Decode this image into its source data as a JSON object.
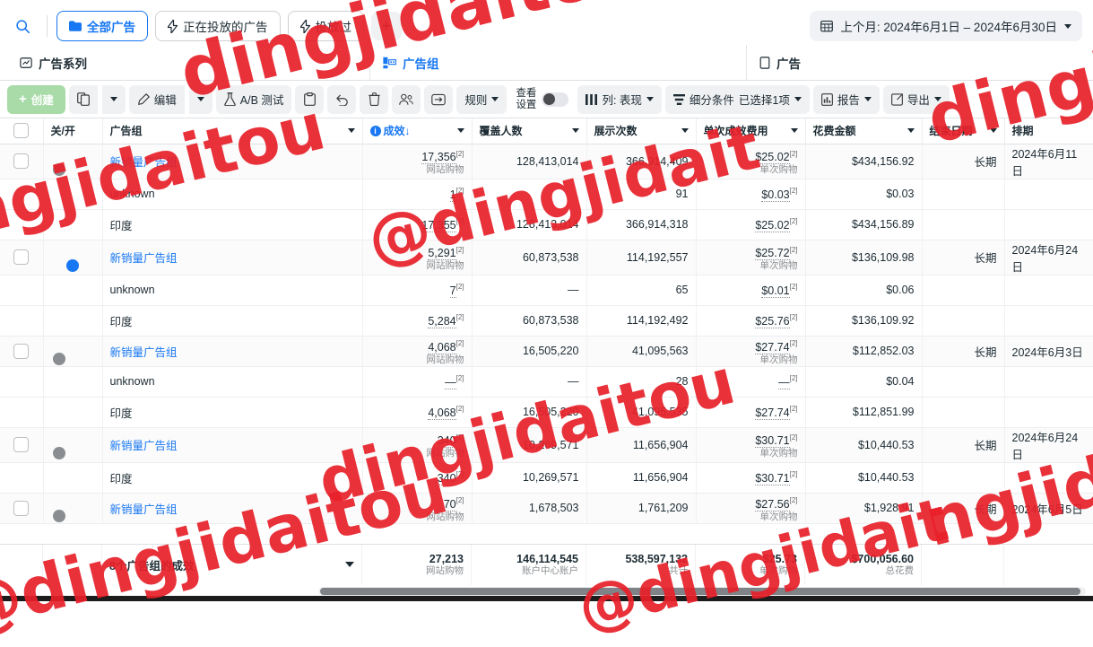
{
  "topbar": {
    "search_icon": "search-icon",
    "filters": [
      {
        "label": "全部广告",
        "icon": "folder-icon",
        "active": true
      },
      {
        "label": "正在投放的广告",
        "icon": "bolt-icon",
        "active": false
      },
      {
        "label": "投放过",
        "icon": "bolt-icon",
        "active": false
      }
    ],
    "add_label": "+",
    "date_range": "上个月: 2024年6月1日 – 2024年6月30日",
    "date_icon": "calendar-icon"
  },
  "object_tabs": [
    {
      "label": "广告系列",
      "icon": "campaign-icon",
      "active": false
    },
    {
      "label": "广告组",
      "icon": "adset-icon",
      "active": true
    },
    {
      "label": "广告",
      "icon": "ad-icon",
      "active": false
    }
  ],
  "toolbar": {
    "create_label": "创建",
    "duplicate_icon": "duplicate-icon",
    "duplicate_caret": "▾",
    "edit_label": "编辑",
    "edit_caret": "▾",
    "abtest_label": "A/B 测试",
    "abtest_icon": "flask-icon",
    "clipboard_icon": "clipboard-icon",
    "undo_icon": "undo-icon",
    "trash_icon": "trash-icon",
    "audience_icon": "audience-icon",
    "refresh_icon": "refresh-icon",
    "rules_label": "规则",
    "viewsettings_line1": "查看",
    "viewsettings_line2": "设置",
    "columns_label": "列: 表现",
    "columns_icon": "columns-icon",
    "breakdown_label": "细分条件",
    "breakdown_value": "已选择1项",
    "breakdown_icon": "breakdown-icon",
    "reports_label": "报告",
    "reports_icon": "report-icon",
    "export_label": "导出",
    "export_icon": "export-icon"
  },
  "table": {
    "headers": {
      "toggle": "关/开",
      "name": "广告组",
      "results": "成效",
      "results_sort": "↓",
      "reach": "覆盖人数",
      "impressions": "展示次数",
      "cost_per_result": "单次成效费用",
      "amount_spent": "花费金额",
      "end_date": "结束日期",
      "schedule": "排期"
    },
    "groups": [
      {
        "name": "新销量广告组",
        "toggle_on": false,
        "results": "17,356",
        "results_sub": "网站购物",
        "reach": "128,413,014",
        "impressions": "366,914,409",
        "cost": "$25.02",
        "cost_sub": "单次购物",
        "spent": "$434,156.92",
        "end_date": "长期",
        "schedule": "2024年6月11日",
        "children": [
          {
            "name": "unknown",
            "results": "1",
            "reach": "",
            "impressions": "91",
            "cost": "$0.03",
            "spent": "$0.03"
          },
          {
            "name": "印度",
            "results": "17,355",
            "reach": "128,413,014",
            "impressions": "366,914,318",
            "cost": "$25.02",
            "spent": "$434,156.89"
          }
        ]
      },
      {
        "name": "新销量广告组",
        "toggle_on": true,
        "results": "5,291",
        "results_sub": "网站购物",
        "reach": "60,873,538",
        "impressions": "114,192,557",
        "cost": "$25.72",
        "cost_sub": "单次购物",
        "spent": "$136,109.98",
        "end_date": "长期",
        "schedule": "2024年6月24日",
        "children": [
          {
            "name": "unknown",
            "results": "7",
            "reach": "—",
            "impressions": "65",
            "cost": "$0.01",
            "spent": "$0.06"
          },
          {
            "name": "印度",
            "results": "5,284",
            "reach": "60,873,538",
            "impressions": "114,192,492",
            "cost": "$25.76",
            "spent": "$136,109.92"
          }
        ]
      },
      {
        "name": "新销量广告组",
        "toggle_on": false,
        "results": "4,068",
        "results_sub": "网站购物",
        "reach": "16,505,220",
        "impressions": "41,095,563",
        "cost": "$27.74",
        "cost_sub": "单次购物",
        "spent": "$112,852.03",
        "end_date": "长期",
        "schedule": "2024年6月3日",
        "children": [
          {
            "name": "unknown",
            "results": "—",
            "reach": "—",
            "impressions": "28",
            "cost": "—",
            "spent": "$0.04"
          },
          {
            "name": "印度",
            "results": "4,068",
            "reach": "16,505,220",
            "impressions": "41,095,535",
            "cost": "$27.74",
            "spent": "$112,851.99"
          }
        ]
      },
      {
        "name": "新销量广告组",
        "toggle_on": false,
        "results": "340",
        "results_sub": "网站购物",
        "reach": "10,269,571",
        "impressions": "11,656,904",
        "cost": "$30.71",
        "cost_sub": "单次购物",
        "spent": "$10,440.53",
        "end_date": "长期",
        "schedule": "2024年6月24日",
        "children": [
          {
            "name": "印度",
            "results": "340",
            "reach": "10,269,571",
            "impressions": "11,656,904",
            "cost": "$30.71",
            "spent": "$10,440.53"
          }
        ]
      },
      {
        "name": "新销量广告组",
        "toggle_on": false,
        "results": "70",
        "results_sub": "网站购物",
        "reach": "1,678,503",
        "impressions": "1,761,209",
        "cost": "$27.56",
        "cost_sub": "单次购物",
        "spent": "$1,928.91",
        "end_date": "长期",
        "schedule": "2024年6月5日",
        "children": []
      }
    ],
    "summary": {
      "label": "8个广告组的成效",
      "results": "27,213",
      "results_sub": "网站购物",
      "reach": "146,114,545",
      "reach_sub": "账户中心账户",
      "impressions": "538,597,132",
      "impressions_sub": "共计",
      "cost": "$25.73",
      "cost_sub": "单次购物",
      "spent": "$700,056.60",
      "spent_sub": "总花费"
    }
  },
  "watermarks": {
    "w1": "dingjidaitou",
    "w2": "ingjidaitou",
    "w3": "@dingjidait",
    "w4": "dingjidaitou",
    "w5": "@dingjidaitou",
    "w6": "dingjidait",
    "w7": "ngjida",
    "w8": "@dingjidait"
  }
}
